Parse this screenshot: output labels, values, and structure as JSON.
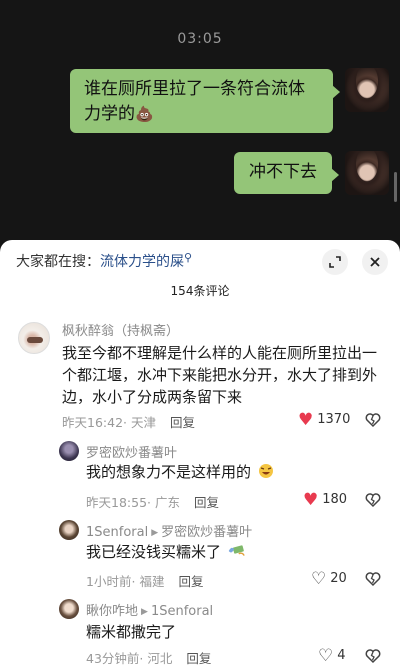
{
  "chat": {
    "time": "03:05",
    "messages": [
      {
        "text": "谁在厕所里拉了一条符合流体力学的",
        "emoji": "💩"
      },
      {
        "text": "冲不下去"
      }
    ]
  },
  "sheet": {
    "search_prefix": "大家都在搜：",
    "search_keyword": "流体力学的屎",
    "comment_count": "154条评论"
  },
  "comments": [
    {
      "name": "枫秋醉翁（持枫斋）",
      "body": "我至今都不理解是什么样的人能在厕所里拉出一个都江堰，水冲下来能把水分开，水大了排到外边，水小了分成两条留下来",
      "time": "昨天16:42",
      "location": "天津",
      "reply": "回复",
      "likes": "1370",
      "liked": true
    },
    {
      "name": "罗密欧炒番薯叶",
      "body": "我的想象力不是这样用的",
      "time": "昨天18:55",
      "location": "广东",
      "reply": "回复",
      "likes": "180",
      "liked": true
    },
    {
      "name": "1Senforal",
      "reply_to": "罗密欧炒番薯叶",
      "body": "我已经没钱买糯米了",
      "time": "1小时前",
      "location": "福建",
      "reply": "回复",
      "likes": "20",
      "liked": false
    },
    {
      "name": "瞅你咋地",
      "reply_to": "1Senforal",
      "body": "糯米都撒完了",
      "time": "43分钟前",
      "location": "河北",
      "reply": "回复",
      "likes": "4",
      "liked": false
    }
  ],
  "colors": {
    "bubble": "#94c578",
    "liked_heart": "#e83a4f",
    "keyword": "#2a4f8a"
  },
  "icons": {
    "expand": "expand-icon",
    "close": "close-icon",
    "like": "heart-icon",
    "dislike": "broken-heart-icon",
    "search": "search-icon"
  }
}
